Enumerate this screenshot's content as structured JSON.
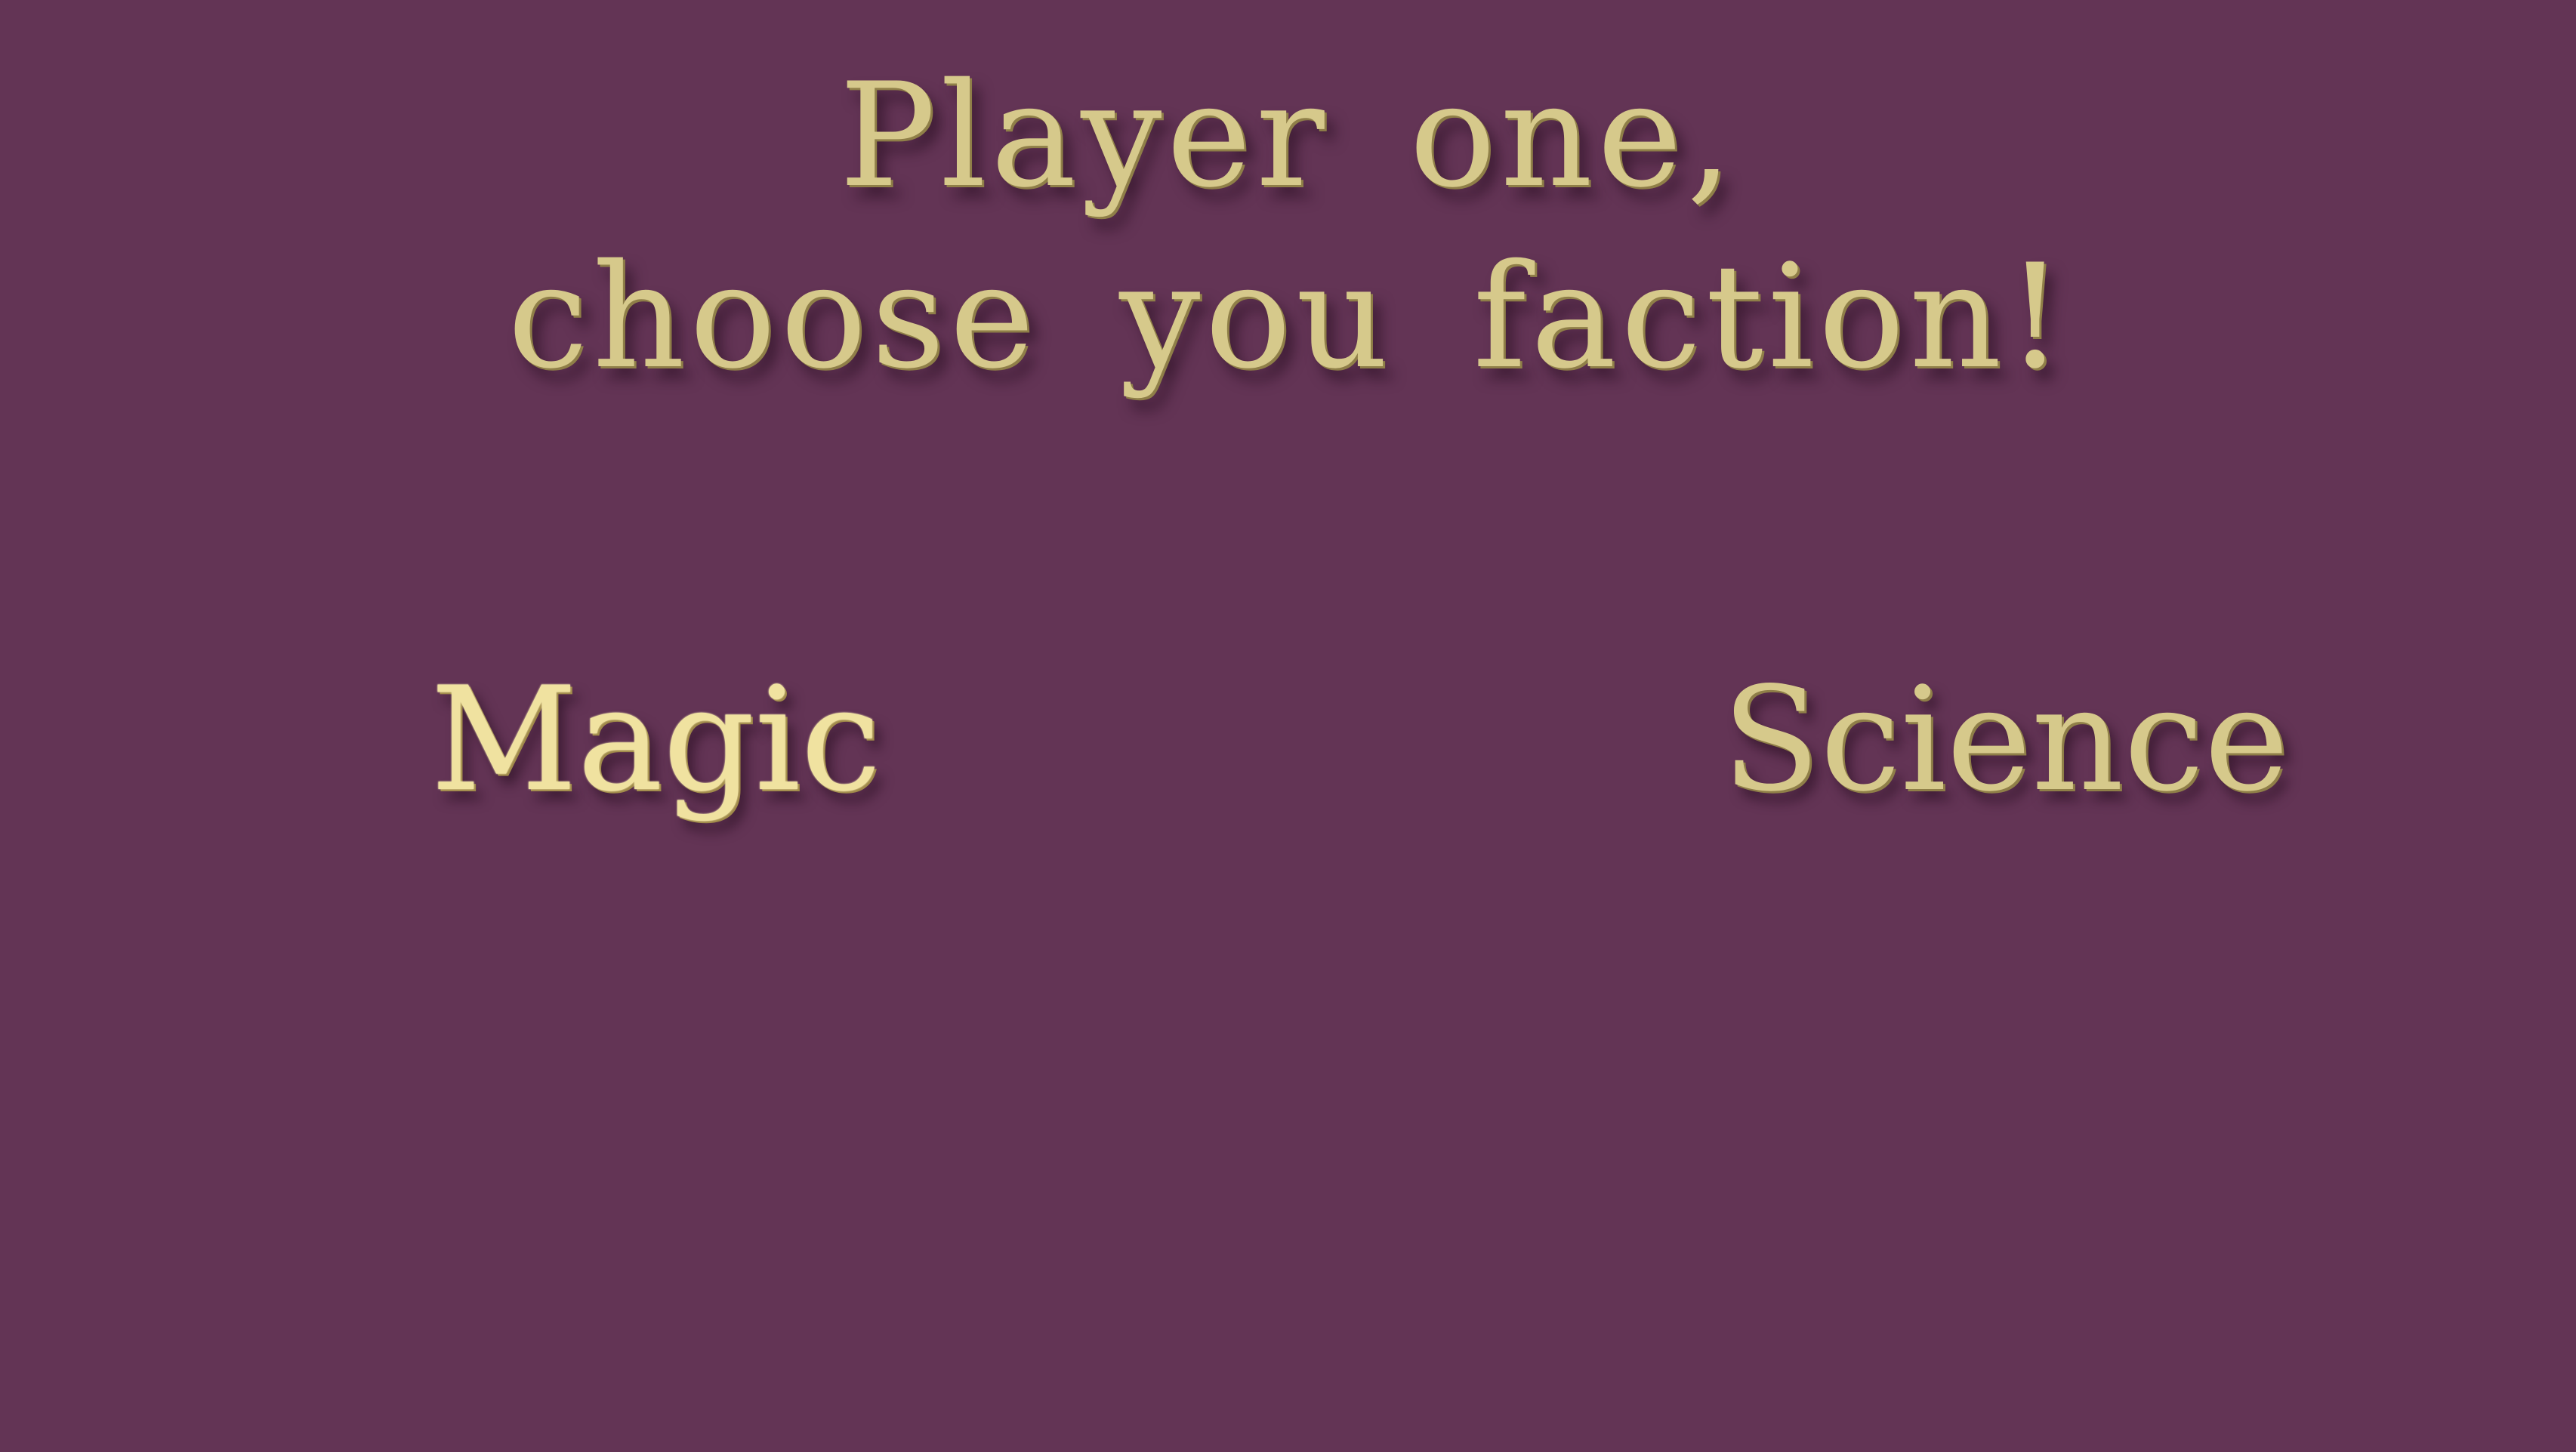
{
  "title": {
    "line1": "Player one,",
    "line2": "choose you faction!"
  },
  "factions": {
    "magic_label": "Magic",
    "science_label": "Science"
  },
  "colors": {
    "background": "#633455",
    "text_gold": "#d6c98b",
    "text_highlight": "#f0e2a0"
  }
}
